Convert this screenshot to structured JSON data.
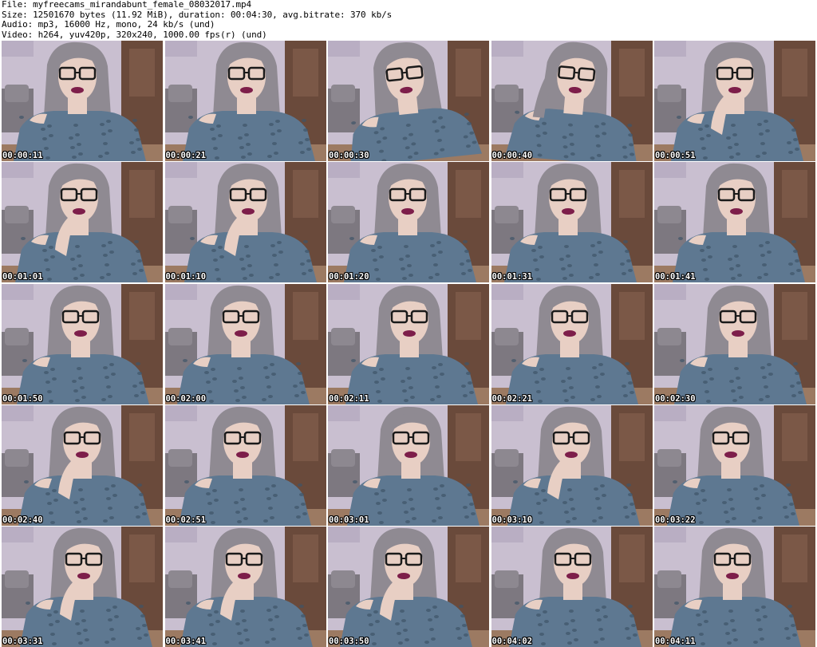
{
  "header": {
    "file_line": "File: myfreecams_mirandabunt_female_08032017.mp4",
    "size_line": "Size: 12501670 bytes (11.92 MiB), duration: 00:04:30, avg.bitrate: 370 kb/s",
    "audio_line": "Audio: mp3, 16000 Hz, mono, 24 kb/s (und)",
    "video_line": "Video: h264, yuv420p, 320x240, 1000.00 fps(r) (und)"
  },
  "colors": {
    "wall": "#c9bfd0",
    "door": "#6a4a3b",
    "sweater": "#5e7891",
    "hair": "#8f8a92",
    "skin": "#e8cfc4",
    "lips": "#7d1e4a",
    "glasses": "#1a1a1a",
    "stamp_text": "#ffffff"
  },
  "thumbnails": [
    {
      "timestamp": "00:00:11",
      "pose": "neutral"
    },
    {
      "timestamp": "00:00:21",
      "pose": "neutral"
    },
    {
      "timestamp": "00:00:30",
      "pose": "tilt-left"
    },
    {
      "timestamp": "00:00:40",
      "pose": "hair-touch"
    },
    {
      "timestamp": "00:00:51",
      "pose": "hand-chin"
    },
    {
      "timestamp": "00:01:01",
      "pose": "hand-chin"
    },
    {
      "timestamp": "00:01:10",
      "pose": "hand-chin"
    },
    {
      "timestamp": "00:01:20",
      "pose": "neutral"
    },
    {
      "timestamp": "00:01:31",
      "pose": "neutral"
    },
    {
      "timestamp": "00:01:41",
      "pose": "neutral"
    },
    {
      "timestamp": "00:01:50",
      "pose": "neutral"
    },
    {
      "timestamp": "00:02:00",
      "pose": "neutral"
    },
    {
      "timestamp": "00:02:11",
      "pose": "neutral"
    },
    {
      "timestamp": "00:02:21",
      "pose": "neutral"
    },
    {
      "timestamp": "00:02:30",
      "pose": "neutral"
    },
    {
      "timestamp": "00:02:40",
      "pose": "hand-chin"
    },
    {
      "timestamp": "00:02:51",
      "pose": "neutral"
    },
    {
      "timestamp": "00:03:01",
      "pose": "neutral"
    },
    {
      "timestamp": "00:03:10",
      "pose": "hand-chin"
    },
    {
      "timestamp": "00:03:22",
      "pose": "neutral"
    },
    {
      "timestamp": "00:03:31",
      "pose": "hand-chin"
    },
    {
      "timestamp": "00:03:41",
      "pose": "hand-chin"
    },
    {
      "timestamp": "00:03:50",
      "pose": "hand-chin"
    },
    {
      "timestamp": "00:04:02",
      "pose": "neutral"
    },
    {
      "timestamp": "00:04:11",
      "pose": "neutral"
    }
  ]
}
